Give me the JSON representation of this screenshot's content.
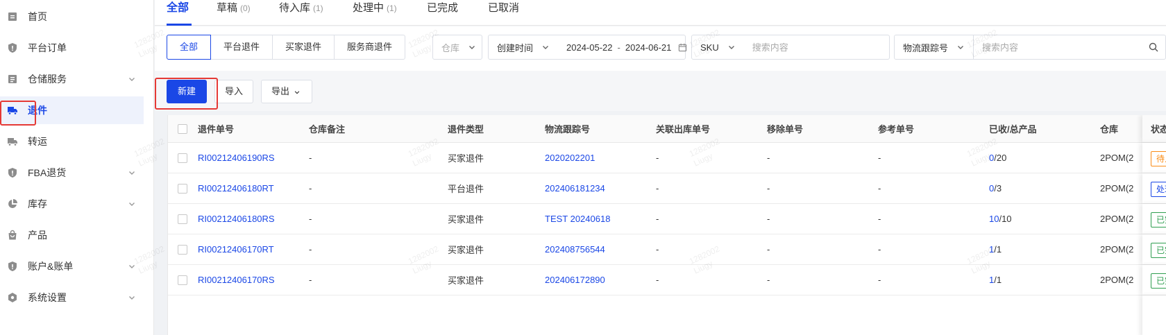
{
  "sidebar": {
    "items": [
      {
        "label": "首页",
        "icon": "home-icon",
        "has_arrow": false,
        "active": false
      },
      {
        "label": "平台订单",
        "icon": "shield-icon",
        "has_arrow": false,
        "active": false
      },
      {
        "label": "仓储服务",
        "icon": "warehouse-icon",
        "has_arrow": true,
        "active": false
      },
      {
        "label": "退件",
        "icon": "truck-icon",
        "has_arrow": false,
        "active": true
      },
      {
        "label": "转运",
        "icon": "truck-icon",
        "has_arrow": false,
        "active": false
      },
      {
        "label": "FBA退货",
        "icon": "shield-icon",
        "has_arrow": true,
        "active": false
      },
      {
        "label": "库存",
        "icon": "pie-chart-icon",
        "has_arrow": true,
        "active": false
      },
      {
        "label": "产品",
        "icon": "bag-icon",
        "has_arrow": false,
        "active": false
      },
      {
        "label": "账户&账单",
        "icon": "shield-icon",
        "has_arrow": true,
        "active": false
      },
      {
        "label": "系统设置",
        "icon": "gear-icon",
        "has_arrow": true,
        "active": false
      }
    ]
  },
  "tabs": [
    {
      "label": "全部",
      "count": "",
      "active": true
    },
    {
      "label": "草稿",
      "count": "(0)",
      "active": false
    },
    {
      "label": "待入库",
      "count": "(1)",
      "active": false
    },
    {
      "label": "处理中",
      "count": "(1)",
      "active": false
    },
    {
      "label": "已完成",
      "count": "",
      "active": false
    },
    {
      "label": "已取消",
      "count": "",
      "active": false
    }
  ],
  "filters": {
    "type_segments": [
      {
        "label": "全部",
        "active": true
      },
      {
        "label": "平台退件",
        "active": false
      },
      {
        "label": "买家退件",
        "active": false
      },
      {
        "label": "服务商退件",
        "active": false
      }
    ],
    "warehouse_placeholder": "仓库",
    "date_field": "创建时间",
    "date_start": "2024-05-22",
    "date_sep": "-",
    "date_end": "2024-06-21",
    "search1_field": "SKU",
    "search1_placeholder": "搜索内容",
    "search2_field": "物流跟踪号",
    "search2_placeholder": "搜索内容"
  },
  "actions": {
    "new_label": "新建",
    "import_label": "导入",
    "export_label": "导出"
  },
  "table": {
    "headers": [
      "退件单号",
      "仓库备注",
      "退件类型",
      "物流跟踪号",
      "关联出库单号",
      "移除单号",
      "参考单号",
      "已收/总产品",
      "仓库",
      "状态"
    ],
    "rows": [
      {
        "id": "RI00212406190RS",
        "note": "-",
        "type": "买家退件",
        "tracking": "2020202201",
        "outbound": "-",
        "removal": "-",
        "ref": "-",
        "received": "0",
        "total": "/20",
        "warehouse": "2POM(2",
        "status": "待入库",
        "status_color": "#fa8c16"
      },
      {
        "id": "RI00212406180RT",
        "note": "-",
        "type": "平台退件",
        "tracking": "202406181234",
        "outbound": "-",
        "removal": "-",
        "ref": "-",
        "received": "0",
        "total": "/3",
        "warehouse": "2POM(2",
        "status": "处理中",
        "status_color": "#1a47e6"
      },
      {
        "id": "RI00212406180RS",
        "note": "-",
        "type": "买家退件",
        "tracking": "TEST 20240618",
        "outbound": "-",
        "removal": "-",
        "ref": "-",
        "received": "10",
        "total": "/10",
        "warehouse": "2POM(2",
        "status": "已完成",
        "status_color": "#2e9e4f"
      },
      {
        "id": "RI00212406170RT",
        "note": "-",
        "type": "买家退件",
        "tracking": "202408756544",
        "outbound": "-",
        "removal": "-",
        "ref": "-",
        "received": "1",
        "total": "/1",
        "warehouse": "2POM(2",
        "status": "已完成",
        "status_color": "#2e9e4f"
      },
      {
        "id": "RI00212406170RS",
        "note": "-",
        "type": "买家退件",
        "tracking": "202406172890",
        "outbound": "-",
        "removal": "-",
        "ref": "-",
        "received": "1",
        "total": "/1",
        "warehouse": "2POM(2",
        "status": "已完成",
        "status_color": "#2e9e4f"
      }
    ]
  },
  "watermark": {
    "line1": "1282002",
    "line2": "Liugy"
  }
}
